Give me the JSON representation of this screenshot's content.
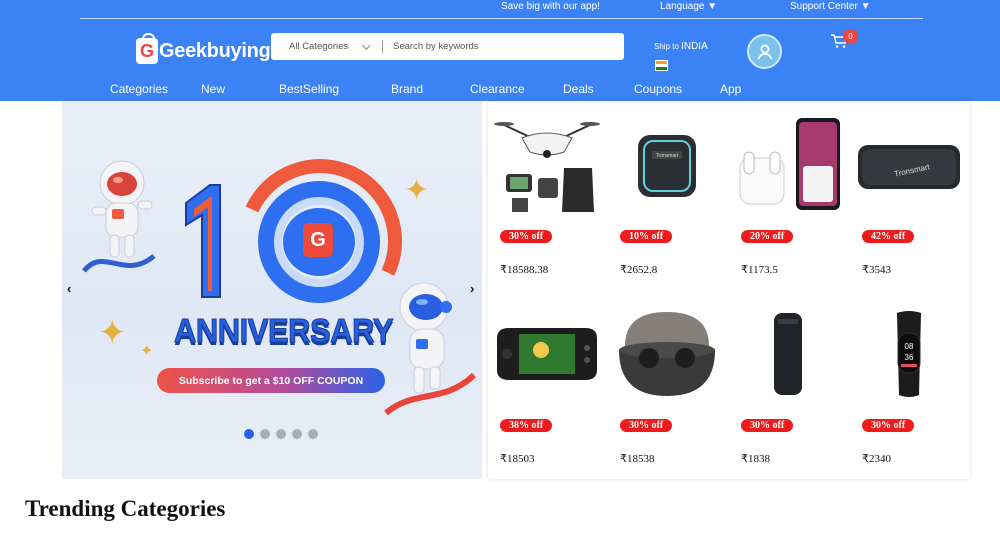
{
  "topbar": {
    "promo": "Save big with our app!",
    "language": "Language ▼",
    "support": "Support Center ▼"
  },
  "logo": {
    "letter": "G",
    "text": "Geekbuying"
  },
  "search": {
    "category": "All Categories",
    "placeholder": "Search by keywords"
  },
  "shipping": {
    "prefix": "Ship to",
    "country": "INDIA"
  },
  "cart": {
    "count": "0"
  },
  "nav": [
    "Categories",
    "New",
    "BestSelling",
    "Brand",
    "Clearance",
    "Deals",
    "Coupons",
    "App"
  ],
  "banner": {
    "logo_letter": "G",
    "title": "ANNIVERSARY",
    "cta": "Subscribe to get a $10 OFF COUPON",
    "prev": "‹",
    "next": "›",
    "slide_count": 5,
    "active_slide": 1
  },
  "products": [
    {
      "name": "drone",
      "discount": "30% off",
      "price": "₹18588.38"
    },
    {
      "name": "speaker-small",
      "discount": "10% off",
      "price": "₹2652.8"
    },
    {
      "name": "earbuds-phone",
      "discount": "20% off",
      "price": "₹1173.5"
    },
    {
      "name": "speaker-bar",
      "discount": "42% off",
      "price": "₹3543"
    },
    {
      "name": "handheld-console",
      "discount": "38% off",
      "price": "₹18503"
    },
    {
      "name": "earbuds-case",
      "discount": "30% off",
      "price": "₹18538"
    },
    {
      "name": "speaker-tower",
      "discount": "30% off",
      "price": "₹1838"
    },
    {
      "name": "smart-band",
      "discount": "30% off",
      "price": "₹2340"
    }
  ],
  "section": {
    "heading": "Trending Categories"
  },
  "colors": {
    "header": "#3b82f6",
    "badge": "#ee1c1c",
    "cart_badge": "#ef4444"
  }
}
